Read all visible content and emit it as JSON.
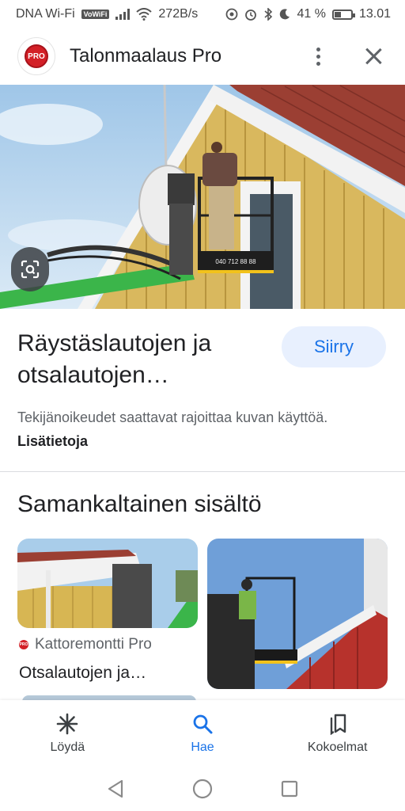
{
  "status_bar": {
    "carrier": "DNA Wi-Fi",
    "vowifi": "VoWiFi",
    "speed": "272B/s",
    "battery": "41 %",
    "battery_level": 0.41,
    "time": "13.01"
  },
  "header": {
    "logo_text": "PRO",
    "title": "Talonmaalaus Pro",
    "icons": {
      "menu": "more-vert-icon",
      "close": "close-icon"
    }
  },
  "result": {
    "title": "Räystäslautojen ja otsalautojen…",
    "go_button": "Siirry",
    "copyright_text": "Tekijänoikeudet saattavat rajoittaa kuvan käyttöä.",
    "more_info": "Lisätietoja",
    "lift_phone": "040 712 88 88"
  },
  "similar": {
    "heading": "Samankaltainen sisältö",
    "cards": [
      {
        "source": "Kattoremontti Pro",
        "source_logo": "PRO",
        "title": "Otsalautojen ja…"
      },
      {
        "source": "",
        "title": ""
      }
    ]
  },
  "bottom_nav": [
    {
      "label": "Löydä",
      "icon": "asterisk-icon",
      "active": false
    },
    {
      "label": "Hae",
      "icon": "search-icon",
      "active": true
    },
    {
      "label": "Kokoelmat",
      "icon": "bookmarks-icon",
      "active": false
    }
  ],
  "colors": {
    "accent": "#1a73e8",
    "accent_bg": "#e8f0fe",
    "brand_red": "#d32027",
    "sky": "#bcd7ee",
    "house_yellow": "#e3c56a",
    "roof_red": "#a0463a",
    "lift_green": "#3bb54a"
  }
}
